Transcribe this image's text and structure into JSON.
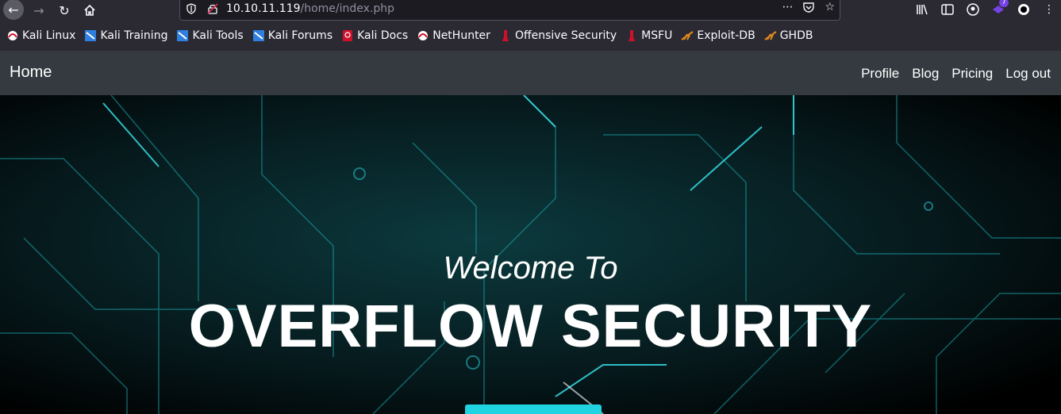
{
  "browser": {
    "url_host": "10.10.11.119",
    "url_path": "/home/index.php",
    "extension_badge": "7"
  },
  "bookmarks": [
    {
      "label": "Kali Linux",
      "icon": "kali-icon"
    },
    {
      "label": "Kali Training",
      "icon": "kali-training-icon"
    },
    {
      "label": "Kali Tools",
      "icon": "kali-tools-icon"
    },
    {
      "label": "Kali Forums",
      "icon": "kali-forums-icon"
    },
    {
      "label": "Kali Docs",
      "icon": "kali-docs-icon"
    },
    {
      "label": "NetHunter",
      "icon": "nethunter-icon"
    },
    {
      "label": "Offensive Security",
      "icon": "offsec-icon"
    },
    {
      "label": "MSFU",
      "icon": "msfu-icon"
    },
    {
      "label": "Exploit-DB",
      "icon": "exploitdb-icon"
    },
    {
      "label": "GHDB",
      "icon": "ghdb-icon"
    }
  ],
  "site": {
    "brand": "Home",
    "nav": [
      "Profile",
      "Blog",
      "Pricing",
      "Log out"
    ]
  },
  "hero": {
    "welcome": "Welcome To",
    "title": "OVERFLOW SECURITY"
  },
  "colors": {
    "navbar": "#343a40",
    "accent": "#1fd4e0",
    "browser_chrome": "#2b2a33"
  }
}
